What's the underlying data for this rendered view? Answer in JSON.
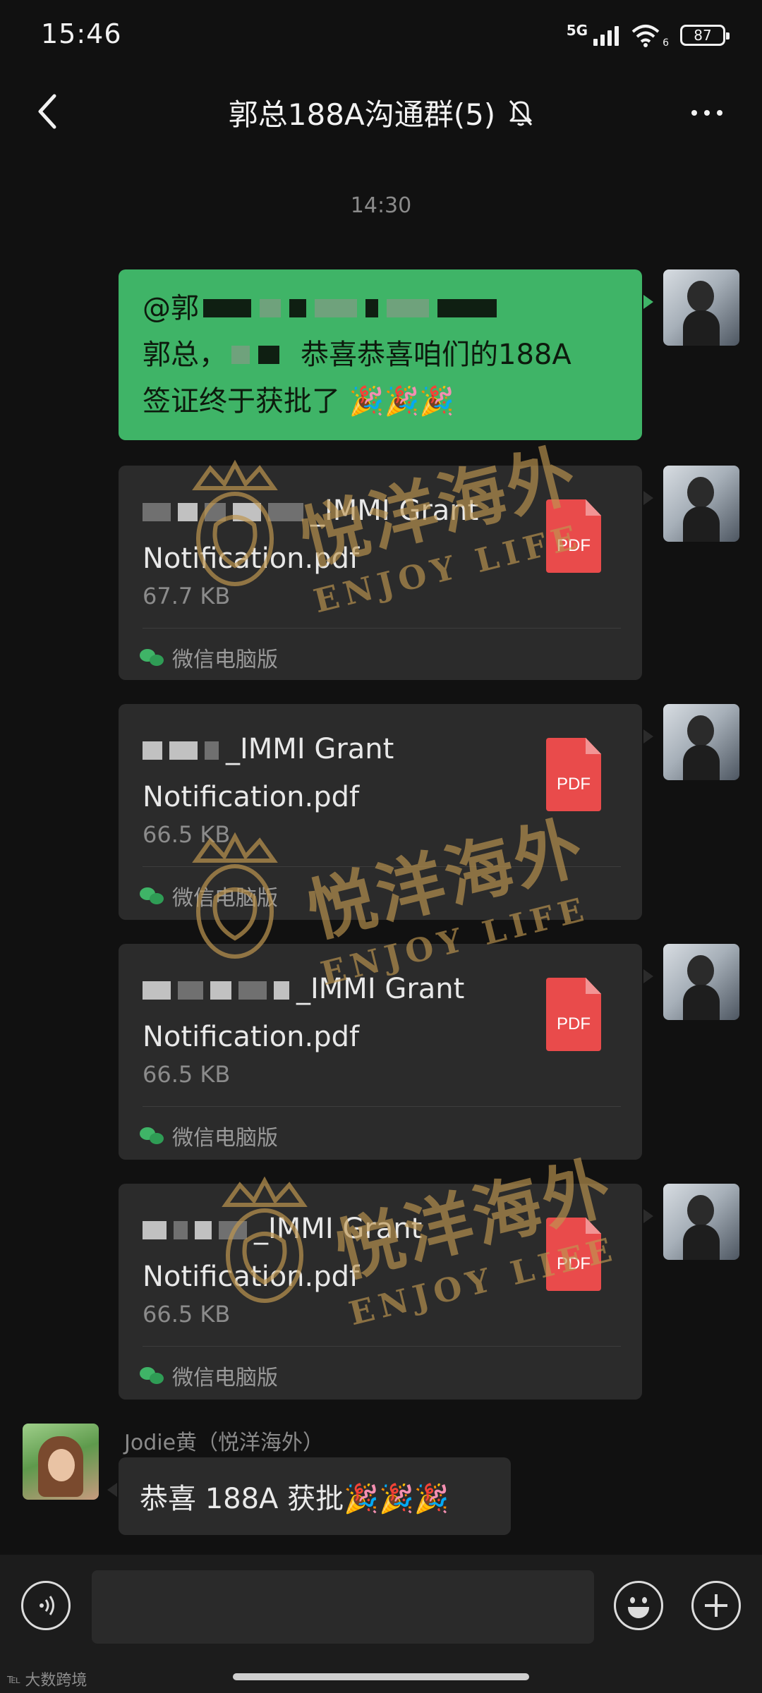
{
  "status_bar": {
    "time": "15:46",
    "network": "5G",
    "wifi_sub": "6",
    "battery": "87"
  },
  "header": {
    "title": "郭总188A沟通群(5)",
    "icons": [
      "back-icon",
      "mute-bell-icon",
      "more-dots-icon"
    ]
  },
  "chat": {
    "timestamp": "14:30",
    "messages": [
      {
        "type": "text",
        "sender": "me",
        "lines": [
          "@郭",
          "郭总，",
          "恭喜恭喜咱们的188A",
          "签证终于获批了 🎉🎉🎉"
        ]
      },
      {
        "type": "file",
        "sender": "me",
        "name_visible": "_IMMI Grant Notification.pdf",
        "size": "67.7 KB",
        "icon_label": "PDF",
        "source": "微信电脑版"
      },
      {
        "type": "file",
        "sender": "me",
        "name_visible": "_IMMI Grant Notification.pdf",
        "size": "66.5 KB",
        "icon_label": "PDF",
        "source": "微信电脑版"
      },
      {
        "type": "file",
        "sender": "me",
        "name_visible": "_IMMI Grant Notification.pdf",
        "size": "66.5 KB",
        "icon_label": "PDF",
        "source": "微信电脑版"
      },
      {
        "type": "file",
        "sender": "me",
        "name_visible": "_IMMI Grant Notification.pdf",
        "size": "66.5 KB",
        "icon_label": "PDF",
        "source": "微信电脑版"
      },
      {
        "type": "text",
        "sender": "Jodie黄（悦洋海外）",
        "text": "恭喜 188A 获批🎉🎉🎉"
      }
    ]
  },
  "input": {
    "placeholder": "",
    "icons": [
      "voice-icon",
      "emoji-icon",
      "plus-icon"
    ]
  },
  "watermark": {
    "cn": "悦洋海外",
    "en": "ENJOY LIFE"
  },
  "corner_mark": "大数跨境",
  "colors": {
    "background": "#111111",
    "my_bubble": "#3fb467",
    "card": "#2b2b2b",
    "pdf_red": "#e94b4b",
    "watermark_gold": "#be9650"
  }
}
